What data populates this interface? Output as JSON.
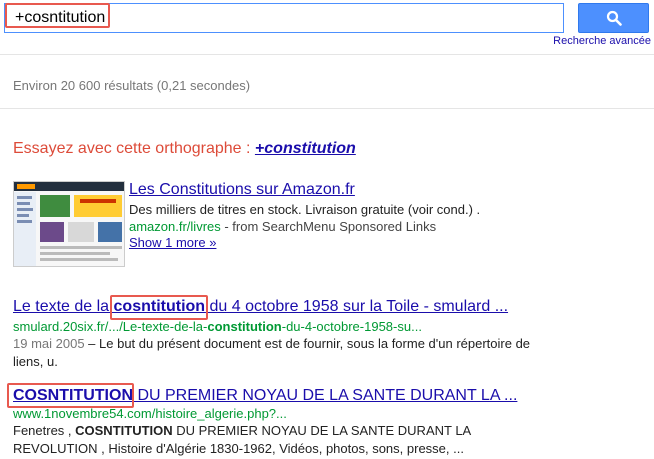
{
  "search": {
    "query": "+cosntitution",
    "button_icon": "search-icon",
    "advanced_link": "Recherche avancée"
  },
  "stats": "Environ 20 600 résultats (0,21 secondes)",
  "spelling": {
    "prefix": "Essayez avec cette orthographe : ",
    "suggestion": "+constitution"
  },
  "ad": {
    "title": "Les Constitutions sur Amazon.fr",
    "snippet": "Des milliers de titres en stock. Livraison gratuite (voir cond.) .",
    "url": "amazon.fr/livres",
    "source": " - from SearchMenu Sponsored Links",
    "more": "Show 1 more »"
  },
  "results": [
    {
      "title_pre": "Le texte de la ",
      "title_hl": "cosntitution",
      "title_post": " du 4 octobre 1958 sur la Toile - smulard ...",
      "url_pre": "smulard.20six.fr/.../Le-texte-de-la-",
      "url_hl": "constitution",
      "url_post": "-du-4-octobre-1958-su...",
      "date": "19 mai 2005",
      "snippet": " – Le but du présent document est de fournir, sous la forme d'un répertoire de liens, u."
    },
    {
      "title_hl": "COSNTITUTION",
      "title_post": " DU PREMIER NOYAU DE LA SANTE DURANT LA ...",
      "url": "www.1novembre54.com/histoire_algerie.php?...",
      "snippet_pre": "Fenetres , ",
      "snippet_hl": "COSNTITUTION",
      "snippet_post": " DU PREMIER NOYAU DE LA SANTE DURANT LA REVOLUTION , Histoire d'Algérie 1830-1962, Vidéos, photos, sons, presse, ..."
    }
  ],
  "colors": {
    "link": "#1a0dab",
    "url_green": "#009933",
    "suggestion_red": "#dd4b39",
    "highlight": "#e8594f",
    "button_blue": "#4d90fe"
  }
}
